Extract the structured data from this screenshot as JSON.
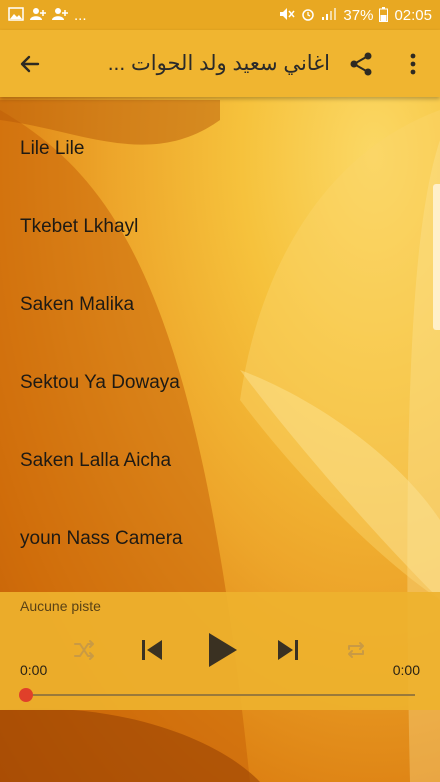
{
  "status_bar": {
    "battery": "37%",
    "time": "02:05",
    "notification_more": "..."
  },
  "app_bar": {
    "title": "اغاني سعيد ولد الحوات ..."
  },
  "songs": [
    {
      "title": "Lile Lile"
    },
    {
      "title": "Tkebet Lkhayl"
    },
    {
      "title": "Saken Malika"
    },
    {
      "title": "Sektou Ya Dowaya"
    },
    {
      "title": "Saken Lalla Aicha"
    },
    {
      "title": "youn Nass Camera"
    }
  ],
  "player": {
    "track_label": "Aucune piste",
    "current_time": "0:00",
    "total_time": "0:00",
    "progress": 0
  },
  "colors": {
    "app_bar": "#f0b530",
    "player_bg": "#eeb22e",
    "seek_thumb": "#e0402a"
  }
}
